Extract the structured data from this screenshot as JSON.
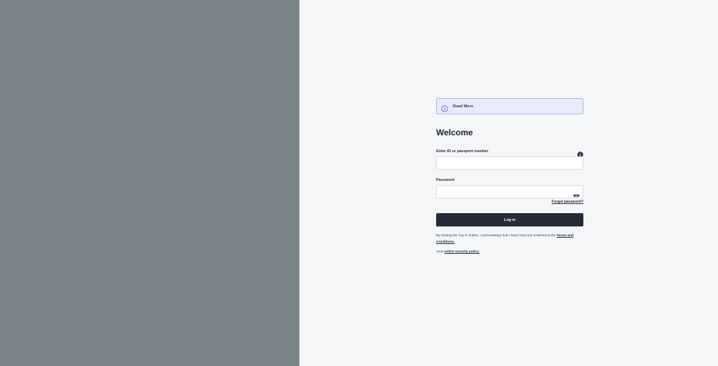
{
  "notice": {
    "text": "Read More",
    "icon": "info-icon"
  },
  "form": {
    "title": "Welcome",
    "id_label": "Enter ID or passport number",
    "id_value": "",
    "id_placeholder": "",
    "password_label": "Password",
    "password_value": "",
    "password_placeholder": "",
    "forgot_label": "Forgot password?",
    "login_label": "Log in"
  },
  "legal": {
    "terms_prefix": "By clicking the 'log in' button, I acknowledge that I have read and understood the ",
    "terms_link": "Terms and Conditions.",
    "policy_prefix": "View ",
    "policy_link": "online security policy."
  },
  "colors": {
    "left_panel": "#7b868b",
    "background": "#f4f6f8",
    "button": "#262b37",
    "notice_bg": "#e8ecfa",
    "notice_border": "#a9b6ea"
  }
}
